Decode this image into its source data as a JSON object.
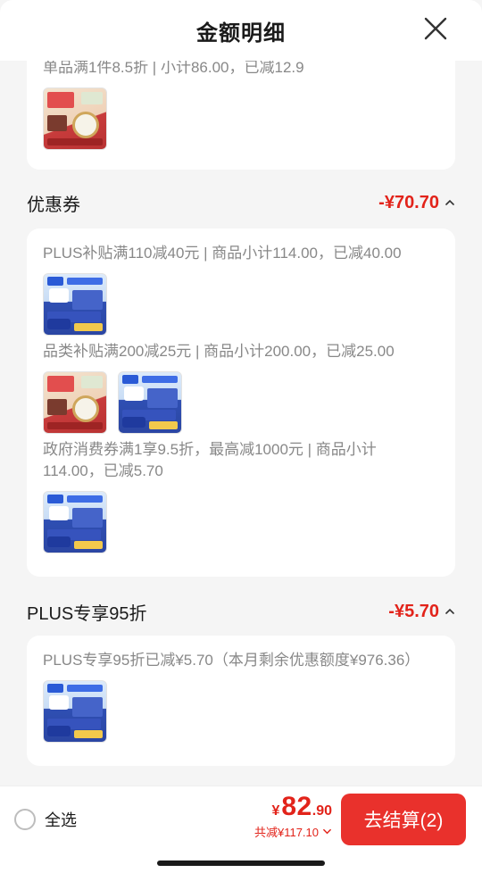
{
  "header": {
    "title": "金额明细"
  },
  "top_card": {
    "text": "单品满1件8.5折 | 小计86.00，已减12.9"
  },
  "coupon": {
    "title": "优惠券",
    "amount": "-¥70.70",
    "rules": [
      {
        "text": "PLUS补贴满110减40元 | 商品小计114.00，已减40.00"
      },
      {
        "text": "品类补贴满200减25元 | 商品小计200.00，已减25.00"
      },
      {
        "text": "政府消费券满1享9.5折，最高减1000元 | 商品小计114.00，已减5.70"
      }
    ]
  },
  "plus": {
    "title": "PLUS专享95折",
    "amount": "-¥5.70",
    "rule_text": "PLUS专享95折已减¥5.70（本月剩余优惠额度¥976.36）"
  },
  "bottom": {
    "select_all": "全选",
    "currency": "¥",
    "price_int": "82",
    "price_dec": ".90",
    "discount": "共减¥117.10",
    "checkout": "去结算(2)"
  },
  "colors": {
    "accent": "#e2231a",
    "checkout_bg": "#e9312c"
  },
  "icons": [
    "close-icon",
    "chevron-up-icon",
    "chevron-down-icon",
    "radio-icon"
  ]
}
